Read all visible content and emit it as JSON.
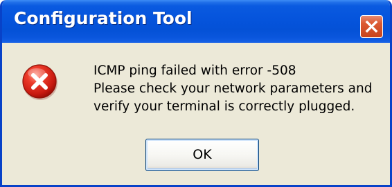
{
  "window": {
    "title": "Configuration Tool",
    "close_icon": "close-icon"
  },
  "dialog": {
    "icon": "error-icon",
    "message_lines": [
      "ICMP ping failed with error -508",
      "Please check your network parameters and",
      "verify your terminal is correctly plugged."
    ],
    "ok_label": "OK"
  },
  "colors": {
    "titlebar": "#0554dc",
    "frame": "#0842c8",
    "dialog_bg": "#ece9d8",
    "close_button": "#dc5a33",
    "error_icon": "#d2261c"
  }
}
